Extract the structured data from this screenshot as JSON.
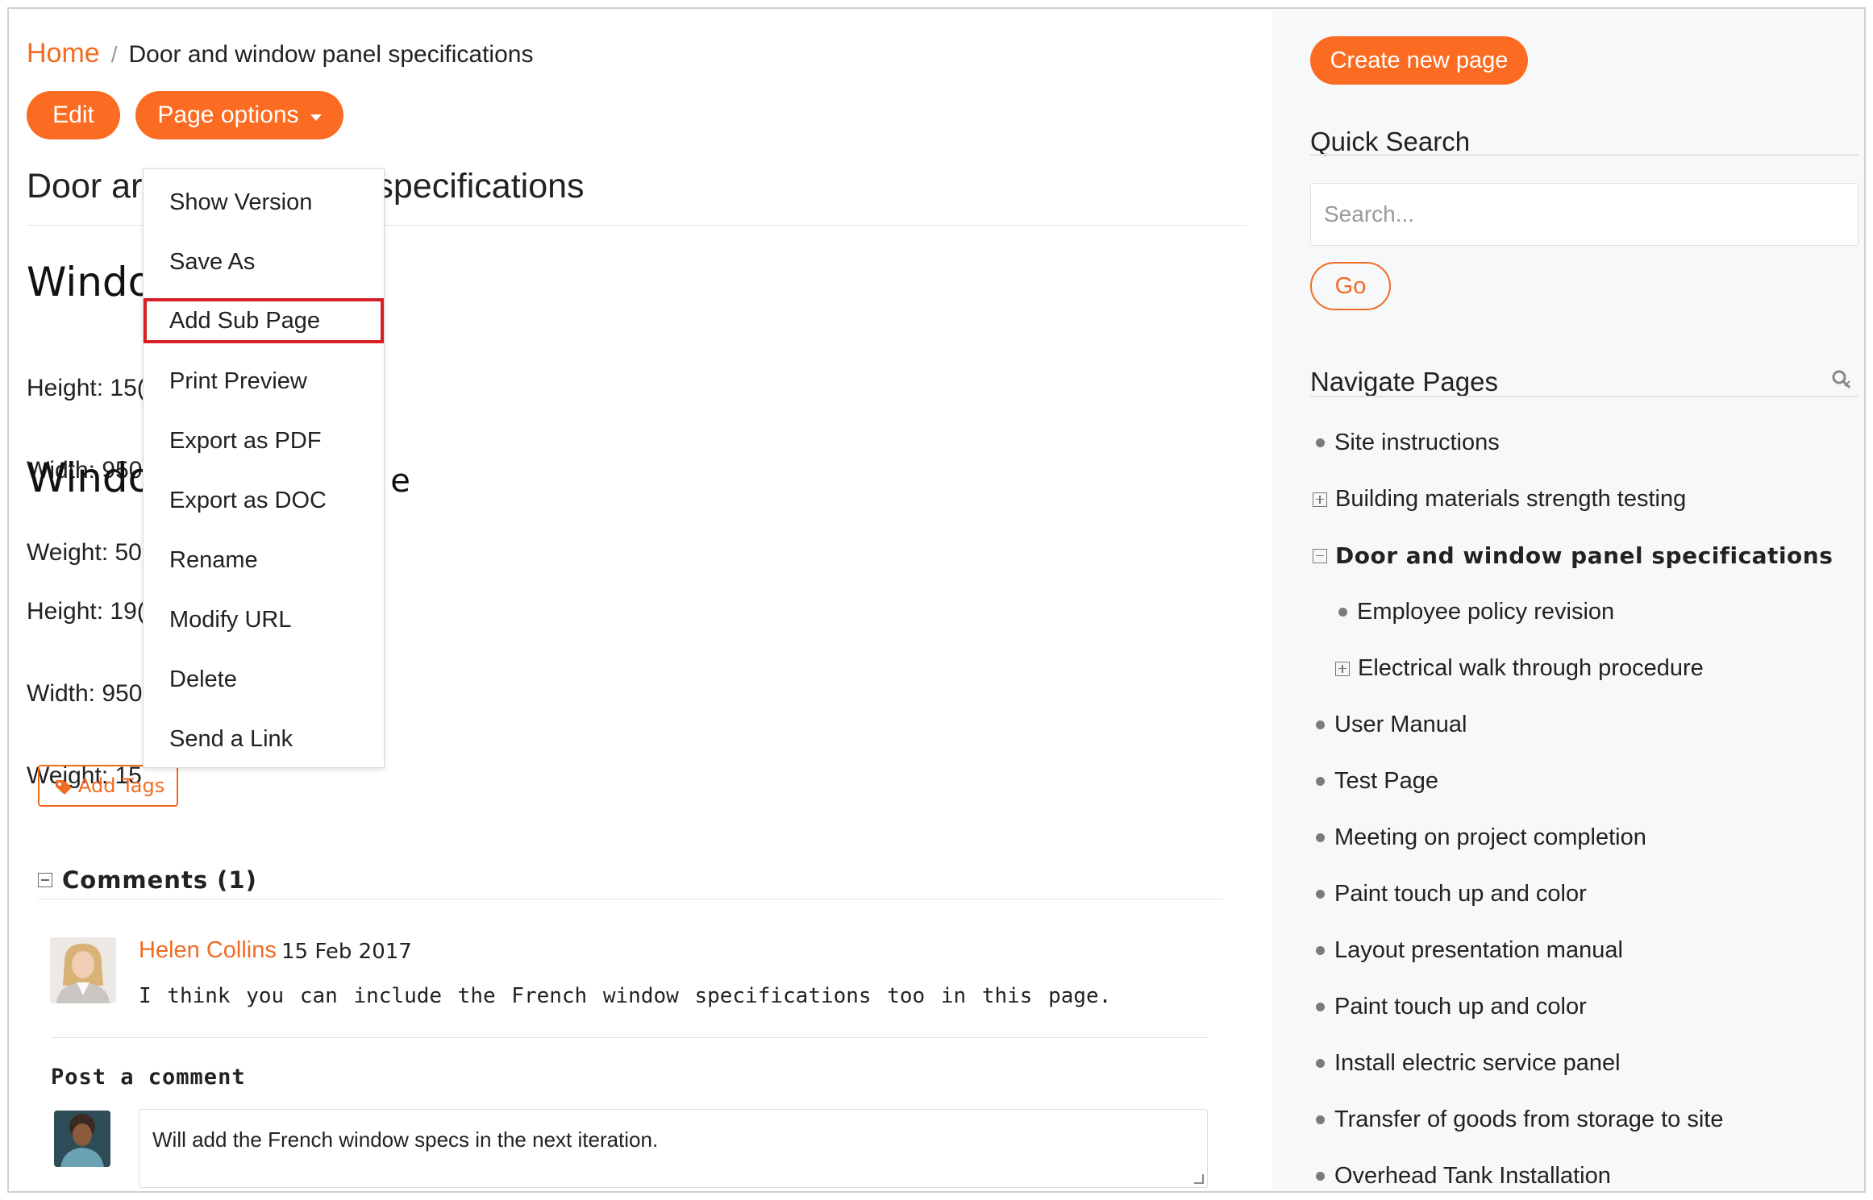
{
  "colors": {
    "accent": "#fb6b21",
    "highlight_border": "#d71f26"
  },
  "breadcrumb": {
    "home": "Home",
    "separator": "/",
    "current": "Door and window panel specifications"
  },
  "toolbar": {
    "edit_label": "Edit",
    "page_options_label": "Page options"
  },
  "page": {
    "title_left": "Door ar",
    "title_right": "specifications",
    "section1_heading": "Windo",
    "section1_lines": [
      "Height: 15(",
      "Width: 950",
      "Weight: 50"
    ],
    "section2_heading": "Windo",
    "section2_tail": "e",
    "section2_lines": [
      "Height: 19(",
      "Width: 950",
      "Weight: 15"
    ],
    "add_tags_label": "Add Tags"
  },
  "page_options_menu": {
    "items": [
      "Show Version",
      "Save As",
      "Add Sub Page",
      "Print Preview",
      "Export as PDF",
      "Export as DOC",
      "Rename",
      "Modify URL",
      "Delete",
      "Send a Link"
    ],
    "highlighted": "Add Sub Page"
  },
  "comments": {
    "heading": "Comments (1)",
    "items": [
      {
        "author": "Helen Collins",
        "date": "15 Feb 2017",
        "text": "I think you can include the French window specifications too in this page."
      }
    ],
    "post_heading": "Post a comment",
    "draft_text": "Will add the French window specs in the next iteration."
  },
  "sidebar": {
    "create_label": "Create new page",
    "quick_search_heading": "Quick Search",
    "search_placeholder": "Search...",
    "go_label": "Go",
    "navigate_heading": "Navigate Pages",
    "nav_items": [
      {
        "label": "Site instructions",
        "marker": "bullet",
        "level": 0
      },
      {
        "label": "Building materials strength testing",
        "marker": "plus",
        "level": 0
      },
      {
        "label": "Door and window panel specifications",
        "marker": "minus",
        "level": 0,
        "current": true
      },
      {
        "label": "Employee policy revision",
        "marker": "bullet",
        "level": 1
      },
      {
        "label": "Electrical walk through procedure",
        "marker": "plus",
        "level": 1
      },
      {
        "label": "User Manual",
        "marker": "bullet",
        "level": 0
      },
      {
        "label": "Test Page",
        "marker": "bullet",
        "level": 0
      },
      {
        "label": "Meeting on project completion",
        "marker": "bullet",
        "level": 0
      },
      {
        "label": "Paint touch up and color",
        "marker": "bullet",
        "level": 0
      },
      {
        "label": "Layout presentation manual",
        "marker": "bullet",
        "level": 0
      },
      {
        "label": "Paint touch up and color",
        "marker": "bullet",
        "level": 0
      },
      {
        "label": "Install electric service panel",
        "marker": "bullet",
        "level": 0
      },
      {
        "label": "Transfer of goods from storage to site",
        "marker": "bullet",
        "level": 0
      },
      {
        "label": "Overhead Tank Installation",
        "marker": "bullet",
        "level": 0
      }
    ]
  }
}
